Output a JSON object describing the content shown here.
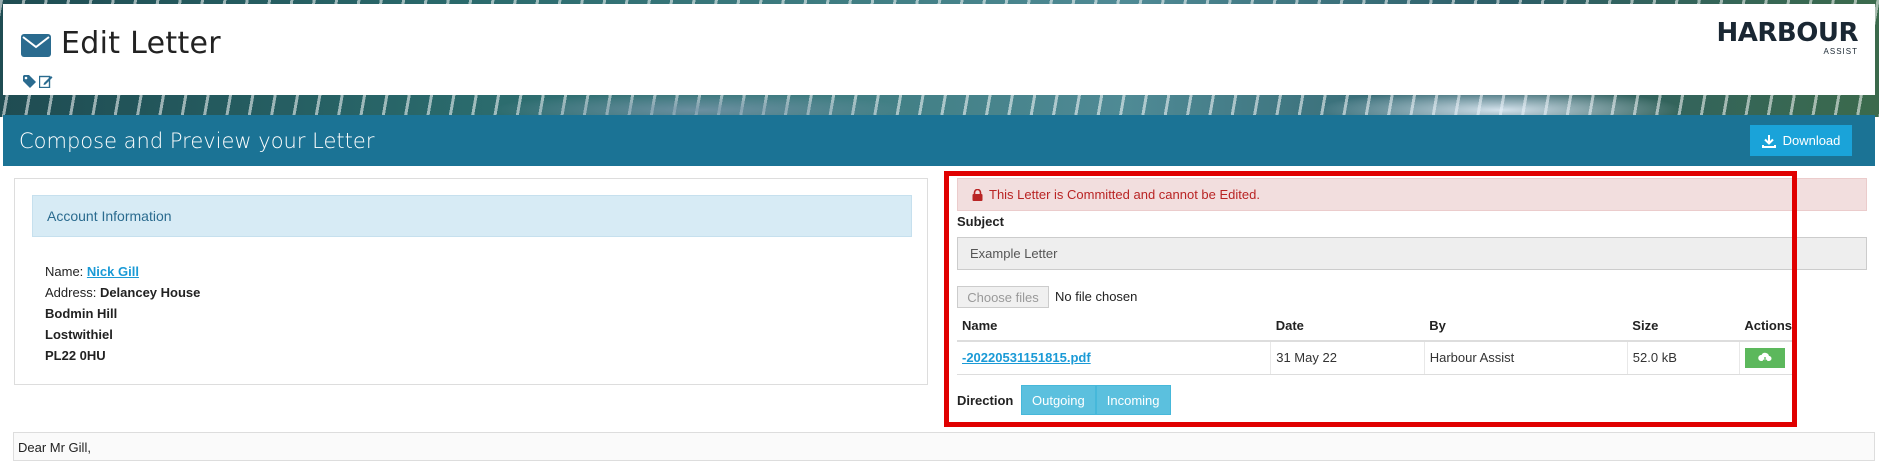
{
  "header": {
    "title": "Edit Letter",
    "title_icon": "envelope-icon",
    "logo_text": "HARBOUR",
    "logo_subtext": "ASSIST"
  },
  "panel": {
    "title": "Compose and Preview your Letter",
    "download_label": "Download"
  },
  "account": {
    "heading": "Account Information",
    "name_label": "Name:",
    "name_value": "Nick Gill",
    "address_label": "Address:",
    "address_lines": [
      "Delancey House",
      "Bodmin Hill",
      "Lostwithiel",
      "PL22 0HU"
    ]
  },
  "alert": {
    "text": "This Letter is Committed and cannot be Edited.",
    "icon": "lock-icon"
  },
  "subject": {
    "label": "Subject",
    "value": "Example Letter"
  },
  "file_upload": {
    "button_label": "Choose files",
    "status": "No file chosen"
  },
  "files_table": {
    "columns": [
      "Name",
      "Date",
      "By",
      "Size",
      "Actions"
    ],
    "rows": [
      {
        "name": "-20220531151815.pdf",
        "date": "31 May 22",
        "by": "Harbour Assist",
        "size": "52.0 kB"
      }
    ]
  },
  "direction": {
    "label": "Direction",
    "options": [
      "Outgoing",
      "Incoming"
    ]
  },
  "letter": {
    "greeting": "Dear Mr Gill,"
  },
  "colors": {
    "panel_header": "#1b7395",
    "download_button": "#1aa3d9",
    "alert_bg": "#f2dede",
    "alert_text": "#b92424",
    "link": "#1a9ad6",
    "direction_button": "#5bc0de",
    "action_button": "#5cb85c",
    "highlight_border": "#e00000"
  }
}
